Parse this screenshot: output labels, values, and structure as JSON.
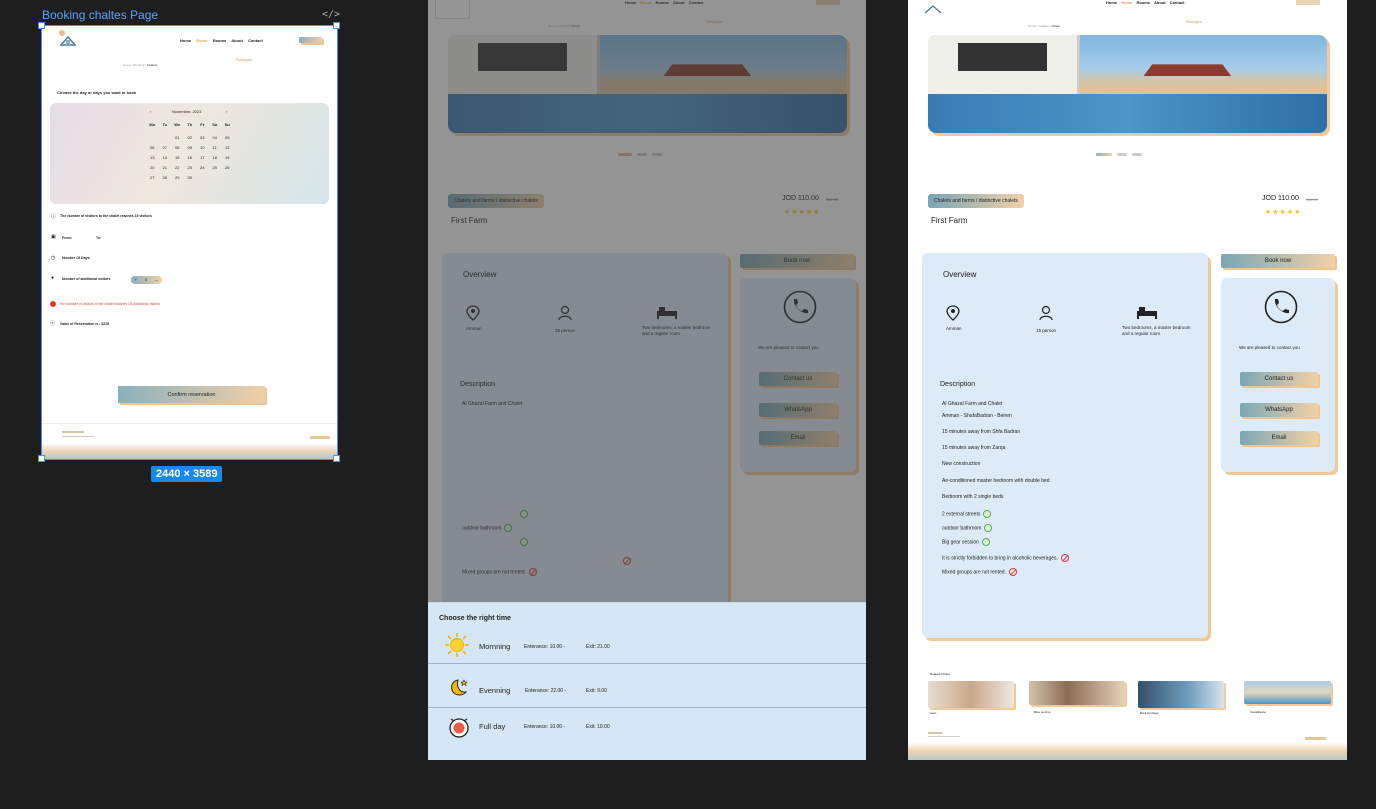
{
  "canvas": {
    "frame_title": "Booking chaltes Page",
    "frame_size": "2440 × 3589",
    "code_glyph": "</>"
  },
  "nav": {
    "items": [
      "Home",
      "Room",
      "Rooms",
      "About",
      "Contact"
    ],
    "items2": [
      "Home",
      "Room",
      "Rooms",
      "About",
      "Contact"
    ],
    "items3": [
      "Home",
      "Room",
      "Rooms",
      "About",
      "Contact"
    ]
  },
  "booking": {
    "breadcrumb": [
      "Home",
      "Booking",
      "Chalets"
    ],
    "brand": "Rosegen",
    "choose_label": "Choose the day or days you want to book",
    "calendar": {
      "month": "November, 2023",
      "prev": "‹",
      "next": "›",
      "weekdays": [
        "Mo",
        "Tu",
        "We",
        "Th",
        "Fr",
        "Sa",
        "Su"
      ],
      "days": [
        "",
        "",
        "01",
        "02",
        "03",
        "04",
        "05",
        "06",
        "07",
        "08",
        "09",
        "10",
        "11",
        "12",
        "13",
        "14",
        "15",
        "16",
        "17",
        "18",
        "19",
        "20",
        "21",
        "22",
        "23",
        "24",
        "25",
        "26",
        "27",
        "28",
        "29",
        "30",
        "",
        "",
        ""
      ]
    },
    "max_visitors_note": "The number of visitors to the chalet reaches 15 visitors",
    "from_label": "From:",
    "to_label": "To:",
    "days_label": "Number Of Days:",
    "extra_visitors_label": "Number of additional visitors",
    "stepper_plus": "+",
    "stepper_value": "0",
    "stepper_minus": "—",
    "extra_note": "The number of visitors to the chalet reaches 15 Additional visitors",
    "reservation_value": "Value of Reservation is : $225",
    "confirm_button": "Confirm reservation"
  },
  "chalet": {
    "breadcrumb": [
      "Home",
      "Chalets",
      "Chalet"
    ],
    "brand": "Rosegen",
    "tag": "Chalets and farms / distinctive chalets",
    "name": "First Farm",
    "price": "JOD 110.00",
    "old_price": "115.00",
    "stars": "★★★★★",
    "overview_title": "Overview",
    "features": [
      {
        "icon": "location-pin-icon",
        "label": "Amman"
      },
      {
        "icon": "person-icon",
        "label": "15 person"
      },
      {
        "icon": "bed-icon",
        "label": "Two bedrooms, a master bedroom and a regular room"
      }
    ],
    "description_title": "Description",
    "description_lines": [
      "Al Ghazal Farm and Chalet",
      "Amman - ShafaBadran - Beiren",
      "15 minutes away from Shfa Badran",
      "15 minutes away from Zarqa",
      "New construction",
      "Air-conditioned master bedroom with double bed",
      "Bedroom with 2 single beds"
    ],
    "checks": [
      "2 external streets",
      "outdoor bathroom",
      "Big gear session"
    ],
    "bans": [
      "It is strictly forbidden to bring in alcoholic beverages.",
      "Mixed groups are not rented."
    ],
    "book_now": "Book now",
    "contact_text": "We are pleased to contact you",
    "contact_buttons": [
      "Contact us",
      "WhatsApp",
      "Email"
    ],
    "similar_title": "Related Chalet",
    "similar": [
      "Aero ..",
      "Blue sunrise",
      "Bora Heritage",
      "Casablanca"
    ]
  },
  "time_modal": {
    "title": "Choose the right time",
    "options": [
      {
        "icon": "sun-icon",
        "name": "Mornning",
        "entrance": "Enterance:  10.00  -",
        "exit": "Exit: 21.00"
      },
      {
        "icon": "moon-stars-icon",
        "name": "Evenning",
        "entrance": "Enterance:  22.00  -",
        "exit": "Exit: 9.00"
      },
      {
        "icon": "full-day-icon",
        "name": "Full day",
        "entrance": "Enterance:  10.00  -",
        "exit": "Exit: 10.00"
      }
    ]
  },
  "colors": {
    "accent_orange": "#f2c99a",
    "accent_teal": "#79a8b4",
    "panel_blue": "#ddeaf8",
    "selection_blue": "#4b8dfb"
  }
}
